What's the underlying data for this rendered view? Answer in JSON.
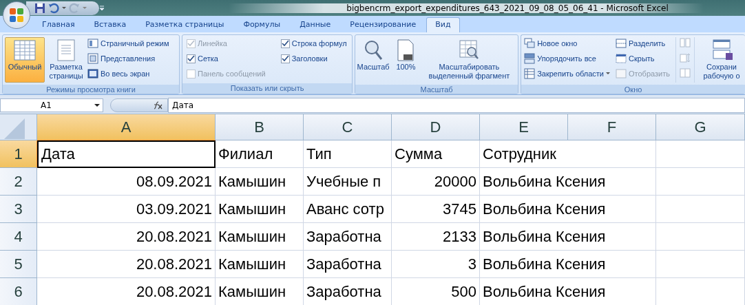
{
  "window": {
    "title": "bigbencrm_export_expenditures_643_2021_09_08_05_06_41 - Microsoft Excel"
  },
  "tabs": [
    {
      "label": "Главная",
      "selected": false
    },
    {
      "label": "Вставка",
      "selected": false
    },
    {
      "label": "Разметка страницы",
      "selected": false
    },
    {
      "label": "Формулы",
      "selected": false
    },
    {
      "label": "Данные",
      "selected": false
    },
    {
      "label": "Рецензирование",
      "selected": false
    },
    {
      "label": "Вид",
      "selected": true
    }
  ],
  "ribbon": {
    "views": {
      "label": "Режимы просмотра книги",
      "large": [
        {
          "label": "Обычный",
          "selected": true
        },
        {
          "label": "Разметка страницы",
          "selected": false
        }
      ],
      "small": [
        "Страничный режим",
        "Представления",
        "Во весь экран"
      ]
    },
    "show": {
      "label": "Показать или скрыть",
      "checks": [
        {
          "label": "Линейка",
          "checked": true,
          "disabled": true
        },
        {
          "label": "Сетка",
          "checked": true,
          "disabled": false
        },
        {
          "label": "Панель сообщений",
          "checked": false,
          "disabled": true
        },
        {
          "label": "Строка формул",
          "checked": true,
          "disabled": false
        },
        {
          "label": "Заголовки",
          "checked": true,
          "disabled": false
        }
      ]
    },
    "zoom": {
      "label": "Масштаб",
      "buttons": [
        "Масштаб",
        "100%",
        "Масштабировать выделенный фрагмент"
      ]
    },
    "window": {
      "label": "Окно",
      "items": [
        {
          "label": "Новое окно",
          "disabled": false,
          "dropdown": false
        },
        {
          "label": "Упорядочить все",
          "disabled": false,
          "dropdown": false
        },
        {
          "label": "Закрепить области",
          "disabled": false,
          "dropdown": true
        },
        {
          "label": "Разделить",
          "disabled": false,
          "dropdown": false
        },
        {
          "label": "Скрыть",
          "disabled": false,
          "dropdown": false
        },
        {
          "label": "Отобразить",
          "disabled": true,
          "dropdown": false
        }
      ],
      "save": "Сохрани рабочую о"
    }
  },
  "formula_bar": {
    "name_box": "A1",
    "value": "Дата"
  },
  "sheet": {
    "columns": [
      {
        "label": "A",
        "selected": true
      },
      {
        "label": "B",
        "selected": false
      },
      {
        "label": "C",
        "selected": false
      },
      {
        "label": "D",
        "selected": false
      },
      {
        "label": "E",
        "selected": false
      },
      {
        "label": "F",
        "selected": false
      },
      {
        "label": "G",
        "selected": false
      }
    ],
    "rows": [
      {
        "label": "1",
        "selected": true,
        "cells": [
          "Дата",
          "Филиал",
          "Тип",
          "Сумма",
          "Сотрудник"
        ]
      },
      {
        "label": "2",
        "selected": false,
        "cells": [
          "08.09.2021",
          "Камышин",
          "Учебные п",
          "20000",
          "Вольбина Ксения"
        ]
      },
      {
        "label": "3",
        "selected": false,
        "cells": [
          "03.09.2021",
          "Камышин",
          "Аванс сотр",
          "3745",
          "Вольбина Ксения"
        ]
      },
      {
        "label": "4",
        "selected": false,
        "cells": [
          "20.08.2021",
          "Камышин",
          "Заработна",
          "2133",
          "Вольбина Ксения"
        ]
      },
      {
        "label": "5",
        "selected": false,
        "cells": [
          "20.08.2021",
          "Камышин",
          "Заработна",
          "3",
          "Вольбина Ксения"
        ]
      },
      {
        "label": "6",
        "selected": false,
        "cells": [
          "20.08.2021",
          "Камышин",
          "Заработна",
          "500",
          "Вольбина Ксения"
        ]
      }
    ]
  }
}
